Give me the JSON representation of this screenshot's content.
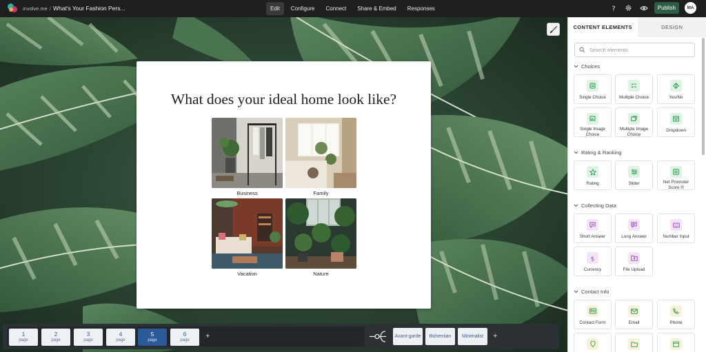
{
  "topbar": {
    "brand": "involve.me",
    "separator": "/",
    "project_title": "What's Your Fashion Pers...",
    "nav": [
      "Edit",
      "Configure",
      "Connect",
      "Share & Embed",
      "Responses"
    ],
    "active_nav": "Edit",
    "publish_label": "Publish",
    "avatar_initials": "MA",
    "icons": [
      "help-icon",
      "settings-icon",
      "preview-eye-icon"
    ]
  },
  "canvas": {
    "question": "What does your ideal home look like?",
    "choices": [
      {
        "label": "Business",
        "image": "minimal-rack-room"
      },
      {
        "label": "Family",
        "image": "bright-bay-window-room"
      },
      {
        "label": "Vacation",
        "image": "colorful-boho-living-room"
      },
      {
        "label": "Nature",
        "image": "plant-filled-room"
      }
    ]
  },
  "pagebar": {
    "pages": [
      {
        "number": "1",
        "label": "page"
      },
      {
        "number": "2",
        "label": "page"
      },
      {
        "number": "3",
        "label": "page"
      },
      {
        "number": "4",
        "label": "page"
      },
      {
        "number": "5",
        "label": "page"
      },
      {
        "number": "6",
        "label": "page"
      }
    ],
    "active_page": "5",
    "add_symbol": "+",
    "outcomes": [
      "Avant-garde",
      "Bohemian",
      "Minimalist"
    ]
  },
  "panel": {
    "tabs": [
      "CONTENT ELEMENTS",
      "DESIGN"
    ],
    "active_tab": "CONTENT ELEMENTS",
    "search_placeholder": "Search elements",
    "sections": {
      "choices": {
        "title": "Choices",
        "items": [
          "Single Choice",
          "Multiple Choice",
          "Yes/No",
          "Single Image Choice",
          "Multiple Image Choice",
          "Dropdown"
        ]
      },
      "rating": {
        "title": "Rating & Ranking",
        "items": [
          "Rating",
          "Slider",
          "Net Promoter Score ®"
        ]
      },
      "collecting": {
        "title": "Collecting Data",
        "items": [
          "Short Answer",
          "Long Answer",
          "Number Input",
          "Currency",
          "File Upload"
        ]
      },
      "contact": {
        "title": "Contact Info",
        "items": [
          "Contact Form",
          "Email",
          "Phone"
        ]
      }
    }
  },
  "colors": {
    "topbar_bg": "#1f1f1f",
    "publish_bg": "#2d5e45",
    "page_active": "#2b5a98",
    "icon_green": "#2f9a55",
    "icon_purple": "#a54fbf"
  }
}
